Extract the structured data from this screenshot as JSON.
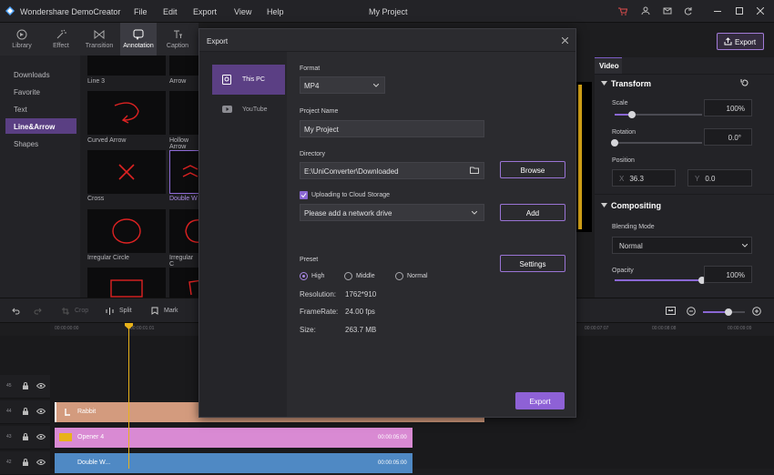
{
  "app": {
    "title": "Wondershare DemoCreator",
    "project": "My Project"
  },
  "menu": [
    "File",
    "Edit",
    "Export",
    "View",
    "Help"
  ],
  "toptabs": [
    {
      "label": "Library",
      "icon": "library-icon"
    },
    {
      "label": "Effect",
      "icon": "effect-icon"
    },
    {
      "label": "Transition",
      "icon": "transition-icon"
    },
    {
      "label": "Annotation",
      "icon": "annotation-icon"
    },
    {
      "label": "Caption",
      "icon": "caption-icon"
    }
  ],
  "categories": [
    "Downloads",
    "Favorite",
    "Text",
    "Line&Arrow",
    "Shapes"
  ],
  "thumbs": [
    {
      "label": "Line 3"
    },
    {
      "label": "Arrow"
    },
    {
      "label": "Curved Arrow"
    },
    {
      "label": "Hollow Arrow"
    },
    {
      "label": "Cross"
    },
    {
      "label": "Double W"
    },
    {
      "label": "Irregular Circle"
    },
    {
      "label": "Irregular C"
    }
  ],
  "export_button": "Export",
  "right_panel": {
    "tab": "Video",
    "transform": "Transform",
    "scale_label": "Scale",
    "scale_value": "100%",
    "rotation_label": "Rotation",
    "rotation_value": "0.0°",
    "position_label": "Position",
    "pos_x_label": "X",
    "pos_x": "36.3",
    "pos_y_label": "Y",
    "pos_y": "0.0",
    "compositing": "Compositing",
    "blending_label": "Blending Mode",
    "blending_value": "Normal",
    "opacity_label": "Opacity",
    "opacity_value": "100%"
  },
  "levels": {
    "scale": 0.2,
    "rotation": 0.0,
    "opacity": 1.0,
    "zoom": 0.6
  },
  "toolbar": {
    "crop": "Crop",
    "split": "Split",
    "mark": "Mark"
  },
  "ruler": [
    "00:00:00:00",
    "00:00:01:01",
    "00:00:07:07",
    "00:00:08:08",
    "00:00:09:09"
  ],
  "tracks": [
    {
      "num": "45"
    },
    {
      "num": "44"
    },
    {
      "num": "43"
    },
    {
      "num": "42"
    }
  ],
  "clips": [
    {
      "label": "Rabbit",
      "time": ""
    },
    {
      "label": "Opener 4",
      "time": "00:00:05:00"
    },
    {
      "label": "Double W...",
      "time": "00:00:05:00"
    }
  ],
  "dialog": {
    "title": "Export",
    "nav": [
      {
        "label": "This PC"
      },
      {
        "label": "YouTube"
      }
    ],
    "format_label": "Format",
    "format_value": "MP4",
    "project_label": "Project Name",
    "project_value": "My Project",
    "dir_label": "Directory",
    "dir_value": "E:\\UniConverter\\Downloaded",
    "browse": "Browse",
    "cloud_label": "Uploading to Cloud Storage",
    "network_placeholder": "Please add a network drive",
    "add": "Add",
    "preset_label": "Preset",
    "presets": [
      "High",
      "Middle",
      "Normal"
    ],
    "settings": "Settings",
    "resolution_label": "Resolution:",
    "resolution": "1762*910",
    "framerate_label": "FrameRate:",
    "framerate": "24.00 fps",
    "size_label": "Size:",
    "size": "263.7 MB",
    "export": "Export"
  },
  "colors": {
    "accent": "#8a67d4",
    "selected": "#5a3f83",
    "playhead": "#e8b21a",
    "clip_rabbit": "#d39b7e",
    "clip_opener": "#d98ad3",
    "clip_double": "#4f89c4"
  }
}
